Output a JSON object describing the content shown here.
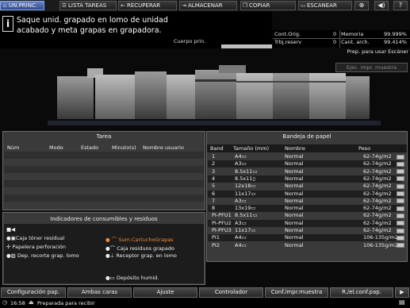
{
  "tabs": [
    {
      "label": "UN.PRINC.",
      "icon": "home-icon"
    },
    {
      "label": "LISTA TAREAS",
      "icon": "list-icon"
    },
    {
      "label": "RECUPERAR",
      "icon": "recover-icon"
    },
    {
      "label": "ALMACENAR",
      "icon": "store-icon"
    },
    {
      "label": "COPIAR",
      "icon": "copy-icon"
    },
    {
      "label": "ESCANEAR",
      "icon": "scan-icon"
    }
  ],
  "message": {
    "line1": "Saque unid. grapado en lomo de unidad",
    "line2": "acabado y meta grapas en grapadora.",
    "body_label": "Cuerpo prin."
  },
  "counters": {
    "cont_orig_label": "Cont.Orig.",
    "cont_orig_value": "0",
    "memoria_label": "Memoria",
    "memoria_value": "99.999%",
    "trbj_label": "Trbj.reserv",
    "trbj_value": "0",
    "cant_arch_label": "Cant. arch.",
    "cant_arch_value": "99.414%"
  },
  "scanner_status": "Prep. para usar Escáner",
  "eject_button": "Ejec. impr. muestra",
  "task_panel": {
    "title": "Tarea",
    "headers": {
      "num": "Núm",
      "modo": "Modo",
      "estado": "Estado",
      "minutos": "Minuto(s)",
      "usuario": "Nombre usuario"
    }
  },
  "tray_panel": {
    "title": "Bandeja de papel",
    "headers": {
      "band": "Band",
      "size": "Tamaño (mm)",
      "name": "Nombre",
      "weight": "Peso"
    },
    "rows": [
      {
        "band": "1",
        "size": "A4▭",
        "name": "Normal",
        "weight": "62-74g/m2"
      },
      {
        "band": "2",
        "size": "A3▭",
        "name": "Normal",
        "weight": "62-74g/m2"
      },
      {
        "band": "3",
        "size": "8.5x11▭",
        "name": "Normal",
        "weight": "62-74g/m2"
      },
      {
        "band": "4",
        "size": "8.5x11▯",
        "name": "Normal",
        "weight": "62-74g/m2"
      },
      {
        "band": "5",
        "size": "12x18▭",
        "name": "Normal",
        "weight": "62-74g/m2"
      },
      {
        "band": "6",
        "size": "11x17▭",
        "name": "Normal",
        "weight": "62-74g/m2"
      },
      {
        "band": "7",
        "size": "A3▭",
        "name": "Normal",
        "weight": "62-74g/m2"
      },
      {
        "band": "8",
        "size": "13x19▭",
        "name": "Normal",
        "weight": "62-74g/m2"
      },
      {
        "band": "PI-PFU1",
        "size": "8.5x11▭",
        "name": "Normal",
        "weight": "62-74g/m2"
      },
      {
        "band": "PI-PFU2",
        "size": "A3▭",
        "name": "Normal",
        "weight": "62-74g/m2"
      },
      {
        "band": "PI-PFU3",
        "size": "11x17▭",
        "name": "Normal",
        "weight": "62-74g/m2"
      },
      {
        "band": "PI1",
        "size": "A4▭",
        "name": "Normal",
        "weight": "106-135g/m2"
      },
      {
        "band": "PI2",
        "size": "A4▭",
        "name": "Normal",
        "weight": "106-135g/m2"
      }
    ]
  },
  "consumables": {
    "title": "Indicadores de consumibles y residuos",
    "toner_box": "Caja tóner residual",
    "punch_box": "Papelera perforación",
    "trim_box": "Dep. recorte grap. lomo",
    "staple_cart": "Sum.CartuchoGrapas",
    "staple_waste": "Caja residuos grapado",
    "spine_receiver": "Receptor grap. en lomo",
    "humid_tank": "Depósito humid.",
    "warn_color": "#f08a3c"
  },
  "bottom_buttons": [
    "Configuración pap.",
    "Ambas caras",
    "Ajuste",
    "Controlador",
    "Conf.impr.muestra",
    "R./el.conf.pap."
  ],
  "footer": {
    "time": "16:58",
    "status": "Preparada para recibir"
  }
}
